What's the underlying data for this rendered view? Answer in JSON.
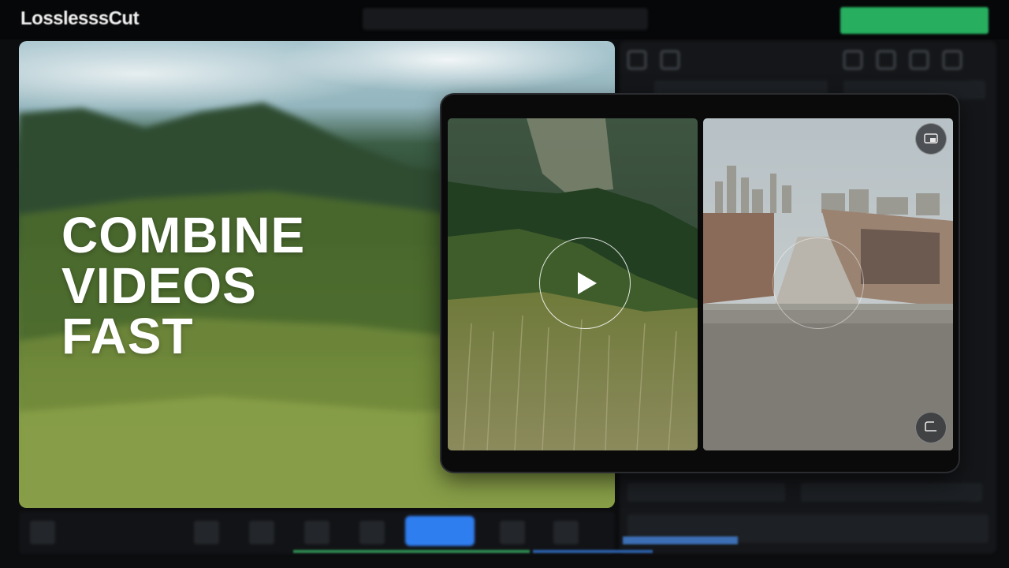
{
  "app": {
    "name": "LosslesssCut"
  },
  "headline": {
    "line1": "COMBINE",
    "line2": "VIDEOS",
    "line3": "FAST"
  },
  "colors": {
    "accent_green": "#27ae5f",
    "accent_blue": "#2f7ef0",
    "background": "#0c0d0f"
  },
  "icons": {
    "play": "play-icon",
    "pip": "picture-in-picture-icon",
    "corner": "corner-resize-icon"
  },
  "tablet": {
    "left_clip": "mountain-grassland-video",
    "right_clip": "city-road-video"
  }
}
